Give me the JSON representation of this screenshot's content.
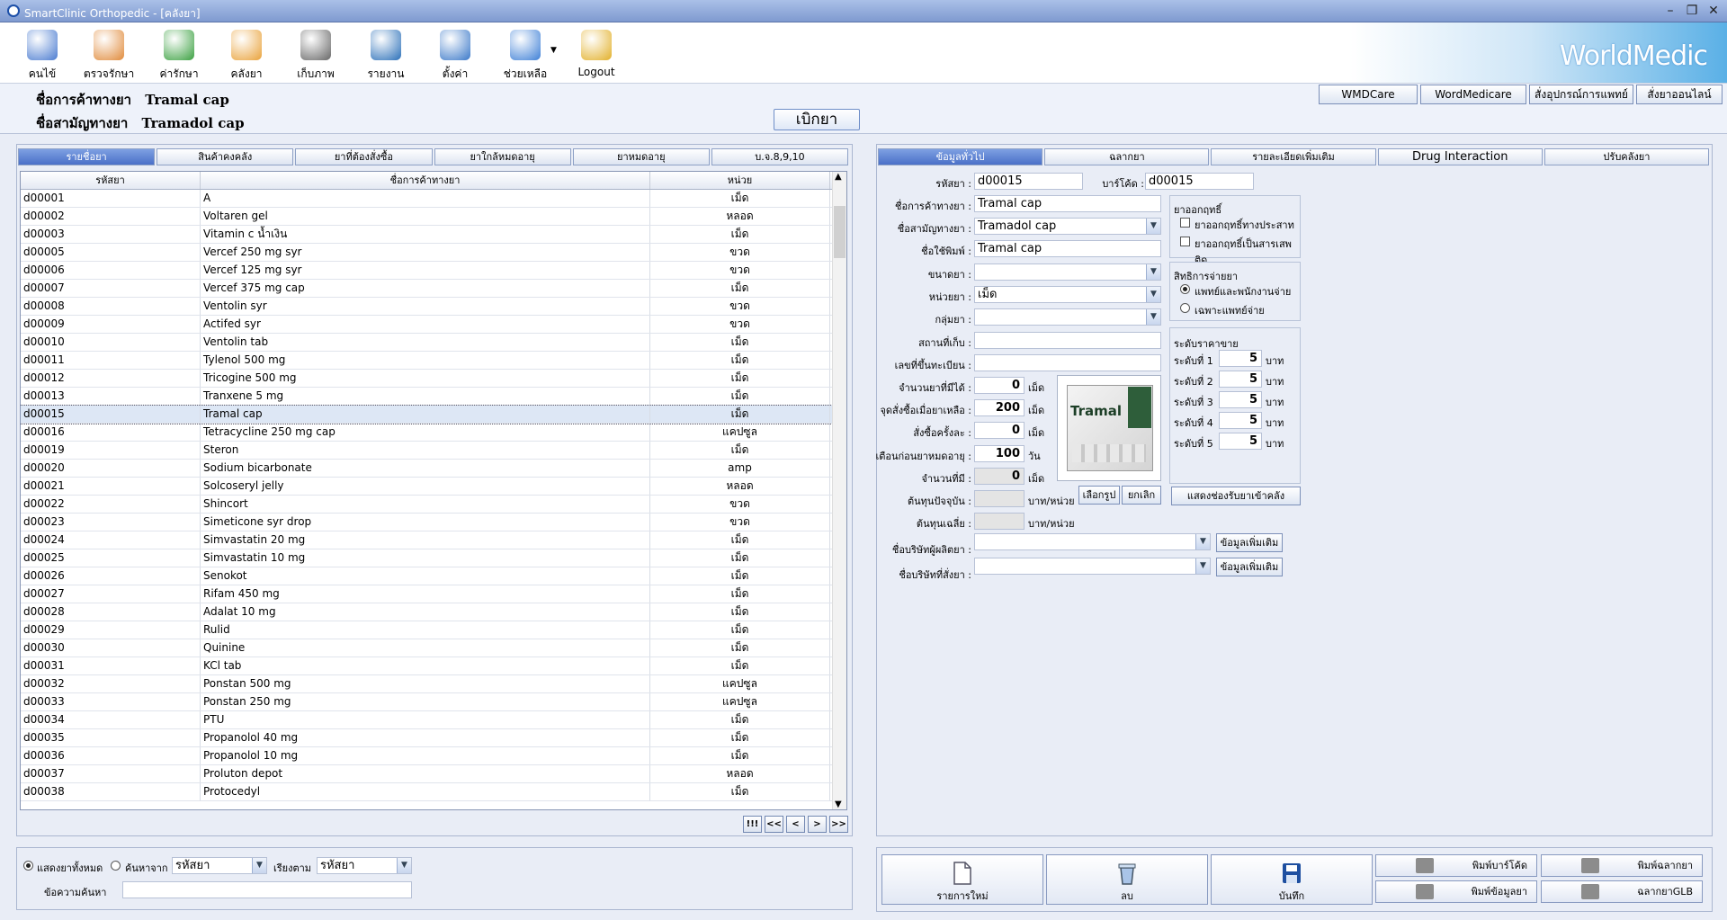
{
  "window": {
    "title": "SmartClinic Orthopedic - [คลังยา]"
  },
  "toolbar": {
    "items": [
      {
        "label": "คนไข้",
        "icon": "patient-card-icon",
        "color": "#4a7bd0"
      },
      {
        "label": "ตรวจรักษา",
        "icon": "doctor-icon",
        "color": "#e08a3a"
      },
      {
        "label": "ค่ารักษา",
        "icon": "money-icon",
        "color": "#3aa040"
      },
      {
        "label": "คลังยา",
        "icon": "capsule-icon",
        "color": "#e9a23a"
      },
      {
        "label": "เก็บภาพ",
        "icon": "camera-icon",
        "color": "#666666"
      },
      {
        "label": "รายงาน",
        "icon": "bar-chart-icon",
        "color": "#2a6fb8"
      },
      {
        "label": "ตั้งค่า",
        "icon": "settings-tools-icon",
        "color": "#3a78c8"
      },
      {
        "label": "ช่วยเหลือ",
        "icon": "help-icon",
        "color": "#3d7fd6"
      },
      {
        "label": "Logout",
        "icon": "lock-icon",
        "color": "#e2b02a"
      }
    ],
    "brand": "WorldMedic"
  },
  "info": {
    "trade_name_label": "ชื่อการค้าทางยา",
    "trade_name": "Tramal cap",
    "generic_name_label": "ชื่อสามัญทางยา",
    "generic_name": "Tramadol cap",
    "open_button": "เบิกยา",
    "links": [
      "WMDCare",
      "WordMedicare",
      "สั่งอุปกรณ์การแพทย์",
      "สั่งยาออนไลน์"
    ]
  },
  "left_tabs": [
    "รายชื่อยา",
    "สินค้าคงคลัง",
    "ยาที่ต้องสั่งซื้อ",
    "ยาใกล้หมดอายุ",
    "ยาหมดอายุ",
    "บ.จ.8,9,10"
  ],
  "grid": {
    "headers": [
      "รหัสยา",
      "ชื่อการค้าทางยา",
      "หน่วย"
    ],
    "rows": [
      [
        "d00001",
        "A",
        "เม็ด"
      ],
      [
        "d00002",
        "Voltaren gel",
        "หลอด"
      ],
      [
        "d00003",
        "Vitamin c น้ำเงิน",
        "เม็ด"
      ],
      [
        "d00005",
        "Vercef 250 mg syr",
        "ขวด"
      ],
      [
        "d00006",
        "Vercef 125 mg syr",
        "ขวด"
      ],
      [
        "d00007",
        "Vercef 375 mg cap",
        "เม็ด"
      ],
      [
        "d00008",
        "Ventolin syr",
        "ขวด"
      ],
      [
        "d00009",
        "Actifed syr",
        "ขวด"
      ],
      [
        "d00010",
        "Ventolin tab",
        "เม็ด"
      ],
      [
        "d00011",
        "Tylenol 500 mg",
        "เม็ด"
      ],
      [
        "d00012",
        "Tricogine 500 mg",
        "เม็ด"
      ],
      [
        "d00013",
        "Tranxene 5 mg",
        "เม็ด"
      ],
      [
        "d00015",
        "Tramal cap",
        "เม็ด"
      ],
      [
        "d00016",
        "Tetracycline 250 mg cap",
        "แคปซูล"
      ],
      [
        "d00019",
        "Steron",
        "เม็ด"
      ],
      [
        "d00020",
        "Sodium bicarbonate",
        "amp"
      ],
      [
        "d00021",
        "Solcoseryl jelly",
        "หลอด"
      ],
      [
        "d00022",
        "Shincort",
        "ขวด"
      ],
      [
        "d00023",
        "Simeticone syr drop",
        "ขวด"
      ],
      [
        "d00024",
        "Simvastatin 20 mg",
        "เม็ด"
      ],
      [
        "d00025",
        "Simvastatin 10 mg",
        "เม็ด"
      ],
      [
        "d00026",
        "Senokot",
        "เม็ด"
      ],
      [
        "d00027",
        "Rifam 450 mg",
        "เม็ด"
      ],
      [
        "d00028",
        "Adalat 10 mg",
        "เม็ด"
      ],
      [
        "d00029",
        "Rulid",
        "เม็ด"
      ],
      [
        "d00030",
        "Quinine",
        "เม็ด"
      ],
      [
        "d00031",
        "KCl tab",
        "เม็ด"
      ],
      [
        "d00032",
        "Ponstan 500 mg",
        "แคปซูล"
      ],
      [
        "d00033",
        "Ponstan 250 mg",
        "แคปซูล"
      ],
      [
        "d00034",
        "PTU",
        "เม็ด"
      ],
      [
        "d00035",
        "Propanolol 40 mg",
        "เม็ด"
      ],
      [
        "d00036",
        "Propanolol 10 mg",
        "เม็ด"
      ],
      [
        "d00037",
        "Proluton depot",
        "หลอด"
      ],
      [
        "d00038",
        "Protocedyl",
        "เม็ด"
      ]
    ],
    "selected_code": "d00015"
  },
  "nav": [
    "!!!",
    "<<",
    "<",
    ">",
    ">>"
  ],
  "search": {
    "show_all": "แสดงยาทั้งหมด",
    "search_from": "ค้นหาจาก",
    "search_field": "รหัสยา",
    "sort_label": "เรียงตาม",
    "sort_field": "รหัสยา",
    "keyword_label": "ข้อความค้นหา",
    "keyword": ""
  },
  "right_tabs": [
    "ข้อมูลทั่วไป",
    "ฉลากยา",
    "รายละเอียดเพิ่มเติม",
    "Drug Interaction",
    "ปรับคลังยา"
  ],
  "form": {
    "code_label": "รหัสยา :",
    "code": "d00015",
    "barcode_label": "บาร์โค้ด :",
    "barcode": "d00015",
    "trade_label": "ชื่อการค้าทางยา :",
    "trade": "Tramal cap",
    "generic_label": "ชื่อสามัญทางยา :",
    "generic": "Tramadol cap",
    "print_label": "ชื่อใช้พิมพ์ :",
    "print": "Tramal cap",
    "size_label": "ขนาดยา :",
    "size": "",
    "unit_label": "หน่วยยา :",
    "unit": "เม็ด",
    "group_label": "กลุ่มยา :",
    "group": "",
    "location_label": "สถานที่เก็บ :",
    "location": "",
    "regno_label": "เลขที่ขึ้นทะเบียน :",
    "regno": "",
    "stock_label": "จำนวนยาที่มีได้ :",
    "stock": "0",
    "stock_unit": "เม็ด",
    "reorder_label": "จุดสั่งซื้อเมื่อยาเหลือ :",
    "reorder": "200",
    "reorder_unit": "เม็ด",
    "order_label": "สั่งซื้อครั้งละ :",
    "order": "0",
    "order_unit": "เม็ด",
    "expire_label": "เตือนก่อนยาหมดอายุ :",
    "expire": "100",
    "expire_unit": "วัน",
    "have_label": "จำนวนที่มี :",
    "have": "0",
    "have_unit": "เม็ด",
    "cost_label": "ต้นทุนปัจจุบัน :",
    "cost": "",
    "cost_unit": "บาท/หน่วย",
    "avgcost_label": "ต้นทุนเฉลี่ย :",
    "avgcost": "",
    "avgcost_unit": "บาท/หน่วย",
    "pick_image": "เลือกรูป",
    "cancel_image": "ยกเลิก",
    "manufacturer_label": "ชื่อบริษัทผู้ผลิตยา :",
    "manufacturer": "",
    "supplier_label": "ชื่อบริษัทที่สั่งยา :",
    "supplier": "",
    "more_info": "ข้อมูลเพิ่มเติม",
    "image_text": "Tramal"
  },
  "legal": {
    "title": "ยาออกฤทธิ์",
    "opt1": "ยาออกฤทธิ์ทางประสาท",
    "opt2": "ยาออกฤทธิ์เป็นสารเสพติด"
  },
  "dispense": {
    "title": "สิทธิการจ่ายยา",
    "opt1": "แพทย์และพนักงานจ่าย",
    "opt2": "เฉพาะแพทย์จ่าย"
  },
  "prices": {
    "title": "ระดับราคาขาย",
    "levels": [
      {
        "label": "ระดับที่ 1",
        "value": "5"
      },
      {
        "label": "ระดับที่ 2",
        "value": "5"
      },
      {
        "label": "ระดับที่ 3",
        "value": "5"
      },
      {
        "label": "ระดับที่ 4",
        "value": "5"
      },
      {
        "label": "ระดับที่ 5",
        "value": "5"
      }
    ],
    "unit": "บาท",
    "receive_button": "แสดงช่องรับยาเข้าคลัง"
  },
  "actions": {
    "new": "รายการใหม่",
    "delete": "ลบ",
    "save": "บันทึก",
    "print_barcode": "พิมพ์บาร์โค้ด",
    "print_label": "พิมพ์ฉลากยา",
    "print_data": "พิมพ์ข้อมูลยา",
    "label_glb": "ฉลากยาGLB"
  }
}
